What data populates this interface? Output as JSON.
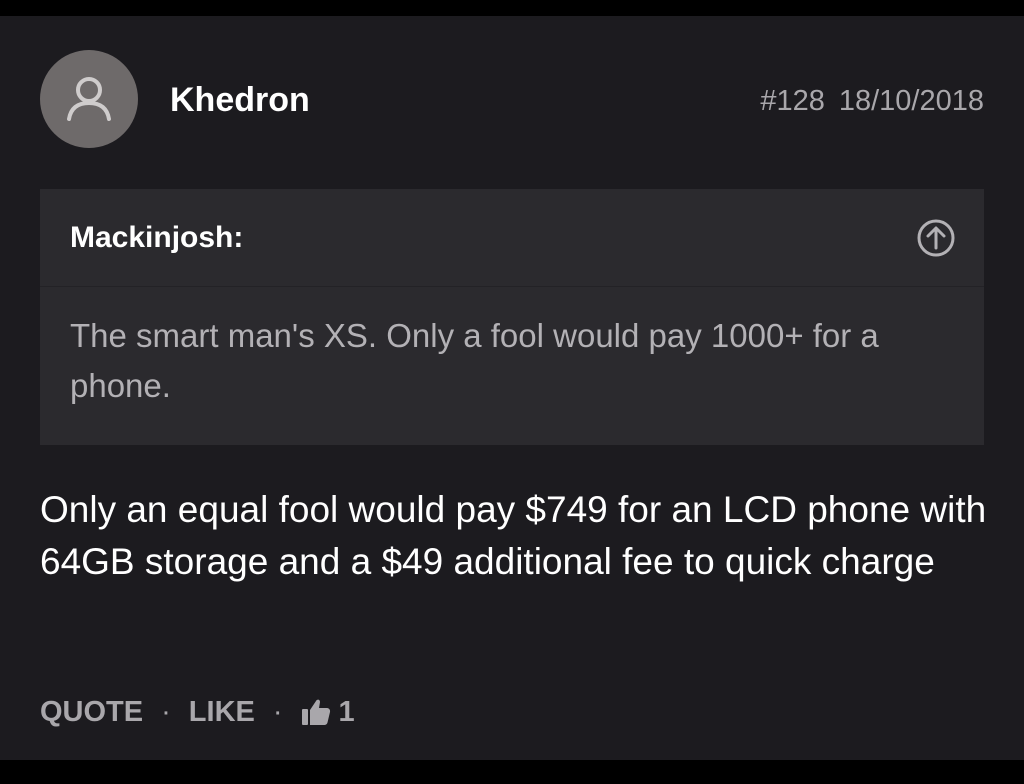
{
  "post": {
    "author": "Khedron",
    "post_number": "#128",
    "date": "18/10/2018",
    "avatar_icon": "user-icon",
    "quote": {
      "author": "Mackinjosh:",
      "text": "The smart man's XS. Only a fool would pay 1000+ for a phone.",
      "jump_icon": "arrow-up-circle-icon"
    },
    "message": "Only an equal fool would pay $749 for an LCD phone with 64GB storage and a $49 additional fee to quick charge",
    "actions": {
      "quote_label": "QUOTE",
      "like_label": "LIKE",
      "separator": "·",
      "like_icon": "thumbs-up-icon",
      "like_count": "1"
    }
  },
  "colors": {
    "background": "#1c1b1f",
    "quote_background": "#2b2a2e",
    "muted_text": "#a9a7ab",
    "avatar": "#6e6a6a"
  }
}
